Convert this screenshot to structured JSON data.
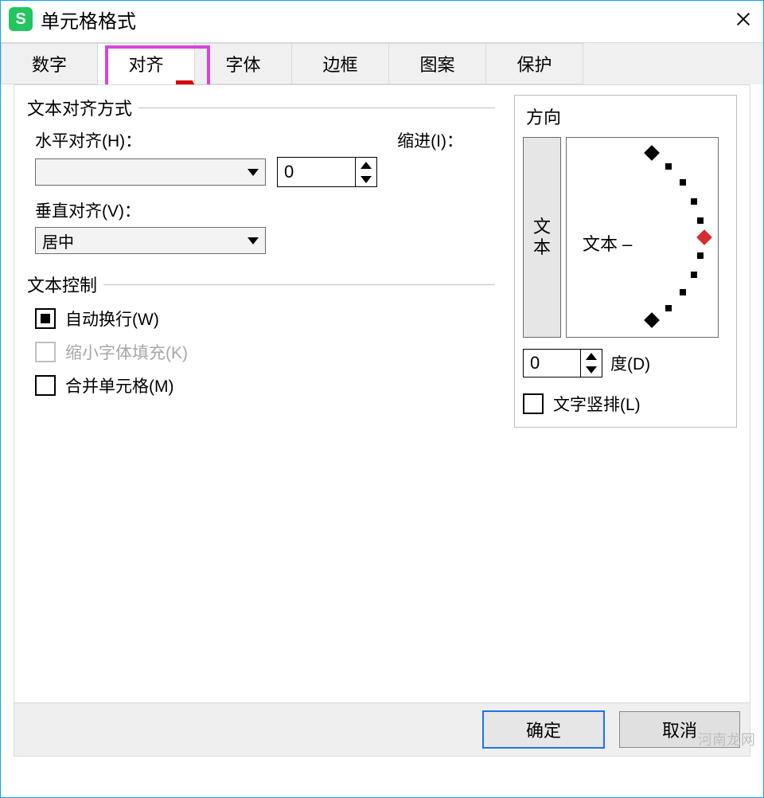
{
  "window": {
    "title": "单元格格式"
  },
  "tabs": [
    "数字",
    "对齐",
    "字体",
    "边框",
    "图案",
    "保护"
  ],
  "active_tab_index": 1,
  "alignment": {
    "group_title": "文本对齐方式",
    "h_label": "水平对齐(H)：",
    "h_value": "",
    "indent_label": "缩进(I)：",
    "indent_value": "0",
    "v_label": "垂直对齐(V)：",
    "v_value": "居中"
  },
  "text_control": {
    "group_title": "文本控制",
    "wrap_label": "自动换行(W)",
    "wrap_checked": true,
    "shrink_label": "缩小字体填充(K)",
    "shrink_disabled": true,
    "merge_label": "合并单元格(M)",
    "merge_checked": false
  },
  "orientation": {
    "group_title": "方向",
    "vertical_text": "文本",
    "dial_label": "文本",
    "degrees_value": "0",
    "degrees_label": "度(D)",
    "vertical_label": "文字竖排(L)",
    "vertical_checked": false
  },
  "buttons": {
    "ok": "确定",
    "cancel": "取消"
  },
  "watermark": "河南龙网"
}
